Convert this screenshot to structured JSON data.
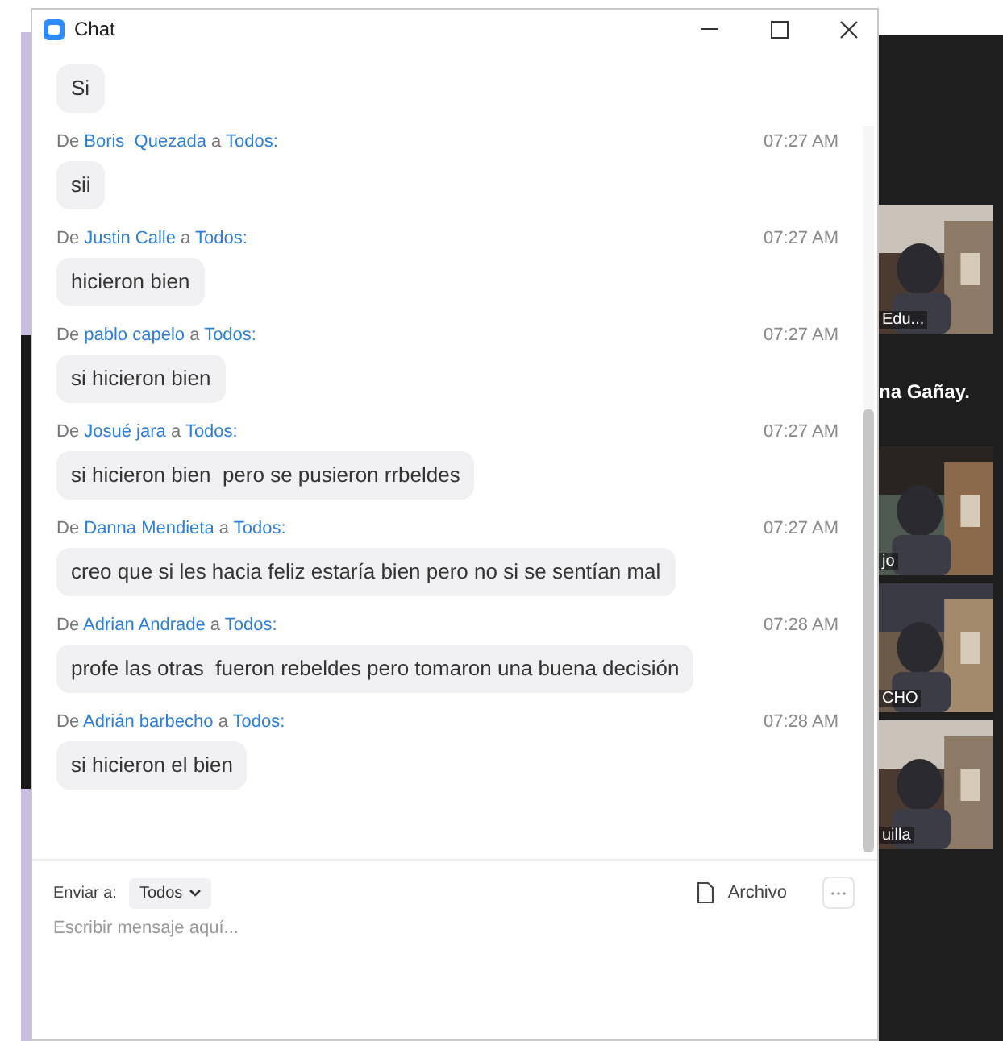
{
  "window": {
    "title": "Chat"
  },
  "messages": [
    {
      "text": "Si"
    },
    {
      "header": {
        "de": "De",
        "from": "Boris  Quezada",
        "a": "a",
        "to": "Todos:"
      },
      "time": "07:27 AM",
      "text": "sii"
    },
    {
      "header": {
        "de": "De",
        "from": "Justin Calle",
        "a": "a",
        "to": "Todos:"
      },
      "time": "07:27 AM",
      "text": "hicieron bien"
    },
    {
      "header": {
        "de": "De",
        "from": "pablo capelo",
        "a": "a",
        "to": "Todos:"
      },
      "time": "07:27 AM",
      "text": "si hicieron bien"
    },
    {
      "header": {
        "de": "De",
        "from": "Josué jara",
        "a": "a",
        "to": "Todos:"
      },
      "time": "07:27 AM",
      "text": "si hicieron bien  pero se pusieron rrbeldes"
    },
    {
      "header": {
        "de": "De",
        "from": "Danna Mendieta",
        "a": "a",
        "to": "Todos:"
      },
      "time": "07:27 AM",
      "text": "creo que si les hacia feliz estaría bien pero no si se sentían mal"
    },
    {
      "header": {
        "de": "De",
        "from": "Adrian Andrade",
        "a": "a",
        "to": "Todos:"
      },
      "time": "07:28 AM",
      "text": "profe las otras  fueron rebeldes pero tomaron una buena decisión"
    },
    {
      "header": {
        "de": "De",
        "from": "Adrián barbecho",
        "a": "a",
        "to": "Todos:"
      },
      "time": "07:28 AM",
      "text": "si hicieron el bien"
    }
  ],
  "compose": {
    "send_to_label": "Enviar a:",
    "recipient": "Todos",
    "file_button": "Archivo",
    "placeholder": "Escribir mensaje aquí..."
  },
  "video_panel": [
    {
      "kind": "dark"
    },
    {
      "kind": "tile",
      "name": "Edu..."
    },
    {
      "kind": "caption",
      "name": "na Gañay."
    },
    {
      "kind": "tile",
      "name": "jo"
    },
    {
      "kind": "tile",
      "name": "CHO"
    },
    {
      "kind": "tile",
      "name": "uilla"
    },
    {
      "kind": "dark"
    }
  ]
}
